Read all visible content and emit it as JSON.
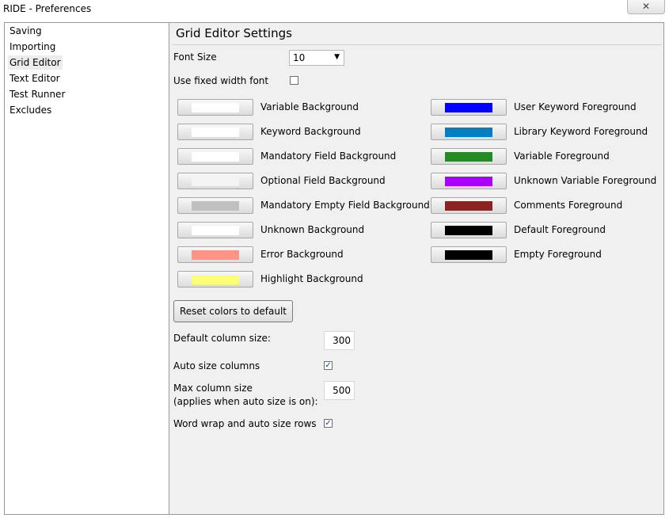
{
  "window": {
    "title": "RIDE - Preferences",
    "close_glyph": "✕"
  },
  "sidebar": {
    "items": [
      {
        "label": "Saving"
      },
      {
        "label": "Importing"
      },
      {
        "label": "Grid Editor"
      },
      {
        "label": "Text Editor"
      },
      {
        "label": "Test Runner"
      },
      {
        "label": "Excludes"
      }
    ],
    "selected": "Grid Editor"
  },
  "panel": {
    "title": "Grid Editor Settings",
    "font_size": {
      "label": "Font Size",
      "value": "10",
      "arrow": "▼"
    },
    "fixed_width_font": {
      "label": "Use fixed width font",
      "checked": false
    },
    "colors_left": [
      {
        "label": "Variable Background",
        "color": "#ffffff"
      },
      {
        "label": "Keyword Background",
        "color": "#ffffff"
      },
      {
        "label": "Mandatory Field Background",
        "color": "#ffffff"
      },
      {
        "label": "Optional Field Background",
        "color": "#f4f4f4"
      },
      {
        "label": "Mandatory Empty Field Background",
        "color": "#c0c0c0"
      },
      {
        "label": "Unknown Background",
        "color": "#ffffff"
      },
      {
        "label": "Error Background",
        "color": "#ff9385"
      },
      {
        "label": "Highlight Background",
        "color": "#ffff77"
      }
    ],
    "colors_right": [
      {
        "label": "User Keyword Foreground",
        "color": "#0000ff"
      },
      {
        "label": "Library Keyword Foreground",
        "color": "#0080c0"
      },
      {
        "label": "Variable Foreground",
        "color": "#228b22"
      },
      {
        "label": "Unknown Variable Foreground",
        "color": "#aa00ff"
      },
      {
        "label": "Comments Foreground",
        "color": "#8b2323"
      },
      {
        "label": "Default Foreground",
        "color": "#000000"
      },
      {
        "label": "Empty Foreground",
        "color": "#000000"
      }
    ],
    "reset_button": "Reset colors to default",
    "default_column_size": {
      "label": "Default column size:",
      "value": "300"
    },
    "auto_size_columns": {
      "label": "Auto size columns",
      "checked": true
    },
    "max_column_size": {
      "label_line1": "Max column size",
      "label_line2": "(applies when auto size is on):",
      "value": "500"
    },
    "word_wrap": {
      "label": "Word wrap and auto size rows",
      "checked": true
    },
    "check_glyph": "✓"
  }
}
